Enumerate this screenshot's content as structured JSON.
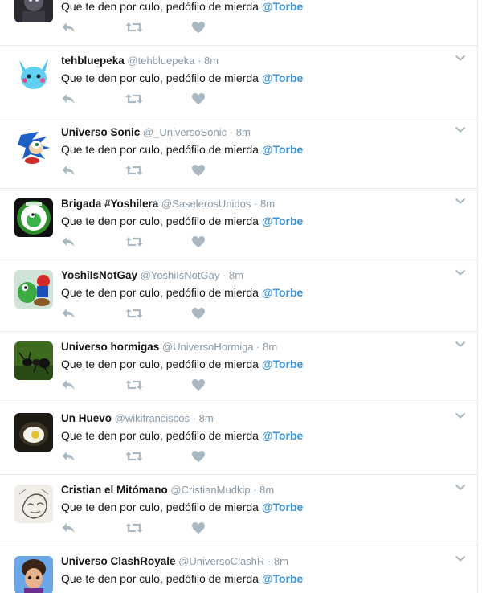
{
  "tweets": [
    {
      "name": "",
      "handle": "",
      "time": "",
      "text": "Que te den por culo, pedófilo de mierda",
      "mention": "@Torbe",
      "avatar": "dark-character-avatar"
    },
    {
      "name": "tehbluepeka",
      "handle": "@tehbluepeka",
      "time": "8m",
      "text": "Que te den por culo, pedófilo de mierda",
      "mention": "@Torbe",
      "avatar": "blue-pikachu-avatar"
    },
    {
      "name": "Universo Sonic",
      "handle": "@_UniversoSonic",
      "time": "8m",
      "text": "Que te den por culo, pedófilo de mierda",
      "mention": "@Torbe",
      "avatar": "sonic-avatar"
    },
    {
      "name": "Brigada #Yoshilera",
      "handle": "@SaselerosUnidos",
      "time": "8m",
      "text": "Que te den por culo, pedófilo de mierda",
      "mention": "@Torbe",
      "avatar": "yoshi-badge-avatar"
    },
    {
      "name": "YoshiIsNotGay",
      "handle": "@YoshiIsNotGay",
      "time": "8m",
      "text": "Que te den por culo, pedófilo de mierda",
      "mention": "@Torbe",
      "avatar": "yoshi-mario-avatar"
    },
    {
      "name": "Universo hormigas",
      "handle": "@UniversoHormiga",
      "time": "8m",
      "text": "Que te den por culo, pedófilo de mierda",
      "mention": "@Torbe",
      "avatar": "ant-avatar"
    },
    {
      "name": "Un Huevo",
      "handle": "@wikifranciscos",
      "time": "8m",
      "text": "Que te den por culo, pedófilo de mierda",
      "mention": "@Torbe",
      "avatar": "egg-avatar"
    },
    {
      "name": "Cristian el Mitómano",
      "handle": "@CristianMudkip",
      "time": "8m",
      "text": "Que te den por culo, pedófilo de mierda",
      "mention": "@Torbe",
      "avatar": "sketch-avatar"
    },
    {
      "name": "Universo ClashRoyale",
      "handle": "@UniversoClashR",
      "time": "8m",
      "text": "Que te den por culo, pedófilo de mierda",
      "mention": "@Torbe",
      "avatar": "clash-royale-avatar"
    }
  ],
  "separator": "·",
  "icons": {
    "reply": "reply-icon",
    "retweet": "retweet-icon",
    "like": "heart-icon",
    "caret": "chevron-down-icon"
  },
  "colors": {
    "mention": "#3b94d9",
    "meta": "#8899a6",
    "icon": "#aab8c2",
    "border": "#e6ecf0"
  }
}
